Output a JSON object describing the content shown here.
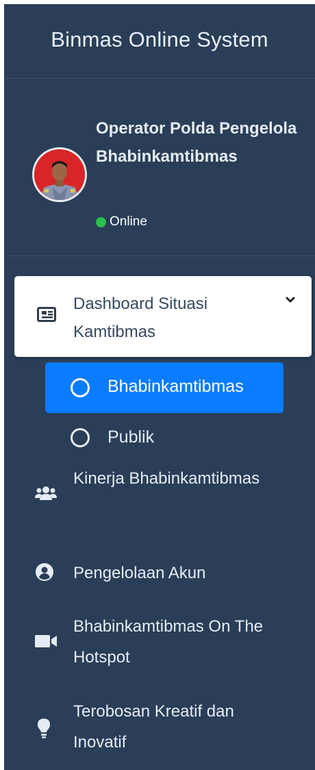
{
  "brand": {
    "title": "Binmas Online System"
  },
  "user": {
    "name": "Operator Polda Pengelola Bhabinkamtibmas",
    "status": "Online",
    "status_color": "#28c04a"
  },
  "menu": {
    "open_item": {
      "label": "Dashboard Situasi Kamtibmas",
      "icon": "newspaper-icon",
      "expanded": true,
      "children": [
        {
          "label": "Bhabinkamtibmas",
          "active": true,
          "icon": "circle-icon"
        },
        {
          "label": "Publik",
          "active": false,
          "icon": "circle-icon"
        }
      ]
    },
    "items": [
      {
        "label": "Kinerja Bhabinkamtibmas",
        "icon": "users-icon"
      },
      {
        "label": "Pengelolaan Akun",
        "icon": "user-circle-icon"
      },
      {
        "label": "Bhabinkamtibmas On The Hotspot",
        "icon": "video-icon"
      },
      {
        "label": "Terobosan Kreatif dan Inovatif",
        "icon": "lightbulb-icon"
      }
    ]
  },
  "colors": {
    "sidebar_bg": "#2a3e58",
    "active_bg": "#0a7cff",
    "text_light": "#e6ecf3",
    "open_item_bg": "#ffffff"
  }
}
